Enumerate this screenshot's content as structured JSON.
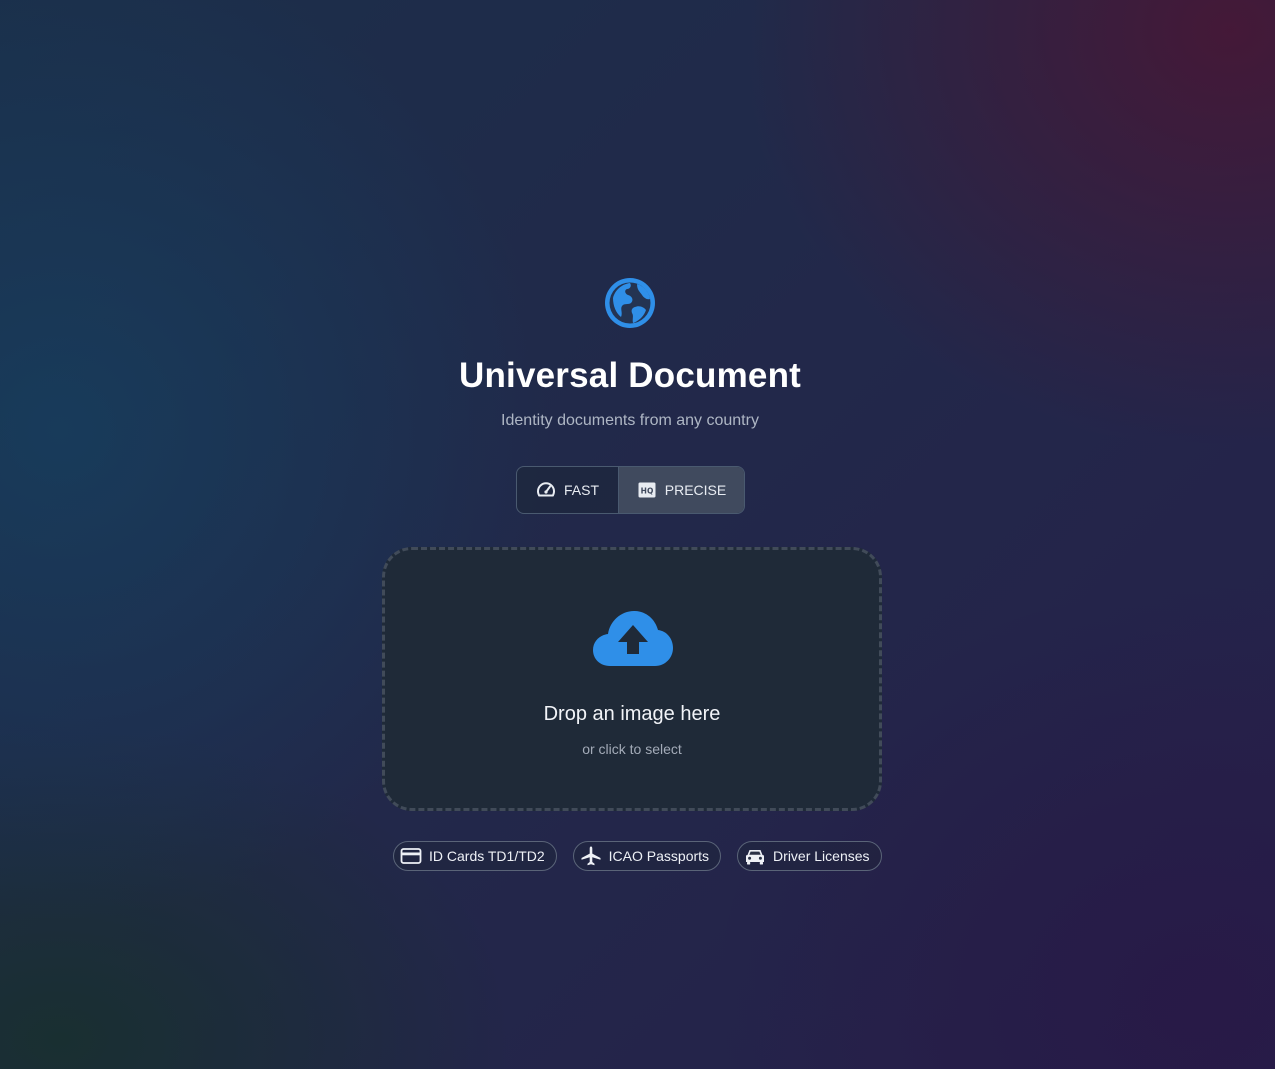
{
  "header": {
    "logo_icon": "globe-icon",
    "title": "Universal Document",
    "subtitle": "Identity documents from any country"
  },
  "mode_toggle": {
    "selected": "PRECISE",
    "options": [
      {
        "label": "FAST",
        "icon": "speedometer-icon"
      },
      {
        "label": "PRECISE",
        "icon": "hq-icon"
      }
    ]
  },
  "dropzone": {
    "icon": "cloud-upload-icon",
    "title": "Drop an image here",
    "subtitle": "or click to select"
  },
  "supported_types": [
    {
      "label": "ID Cards TD1/TD2",
      "icon": "credit-card-icon"
    },
    {
      "label": "ICAO Passports",
      "icon": "airplane-icon"
    },
    {
      "label": "Driver Licenses",
      "icon": "car-icon"
    }
  ],
  "colors": {
    "accent": "#2f8fe8",
    "dropzone_bg": "#1f2a38",
    "selected_mode_bg": "#404a5e"
  }
}
